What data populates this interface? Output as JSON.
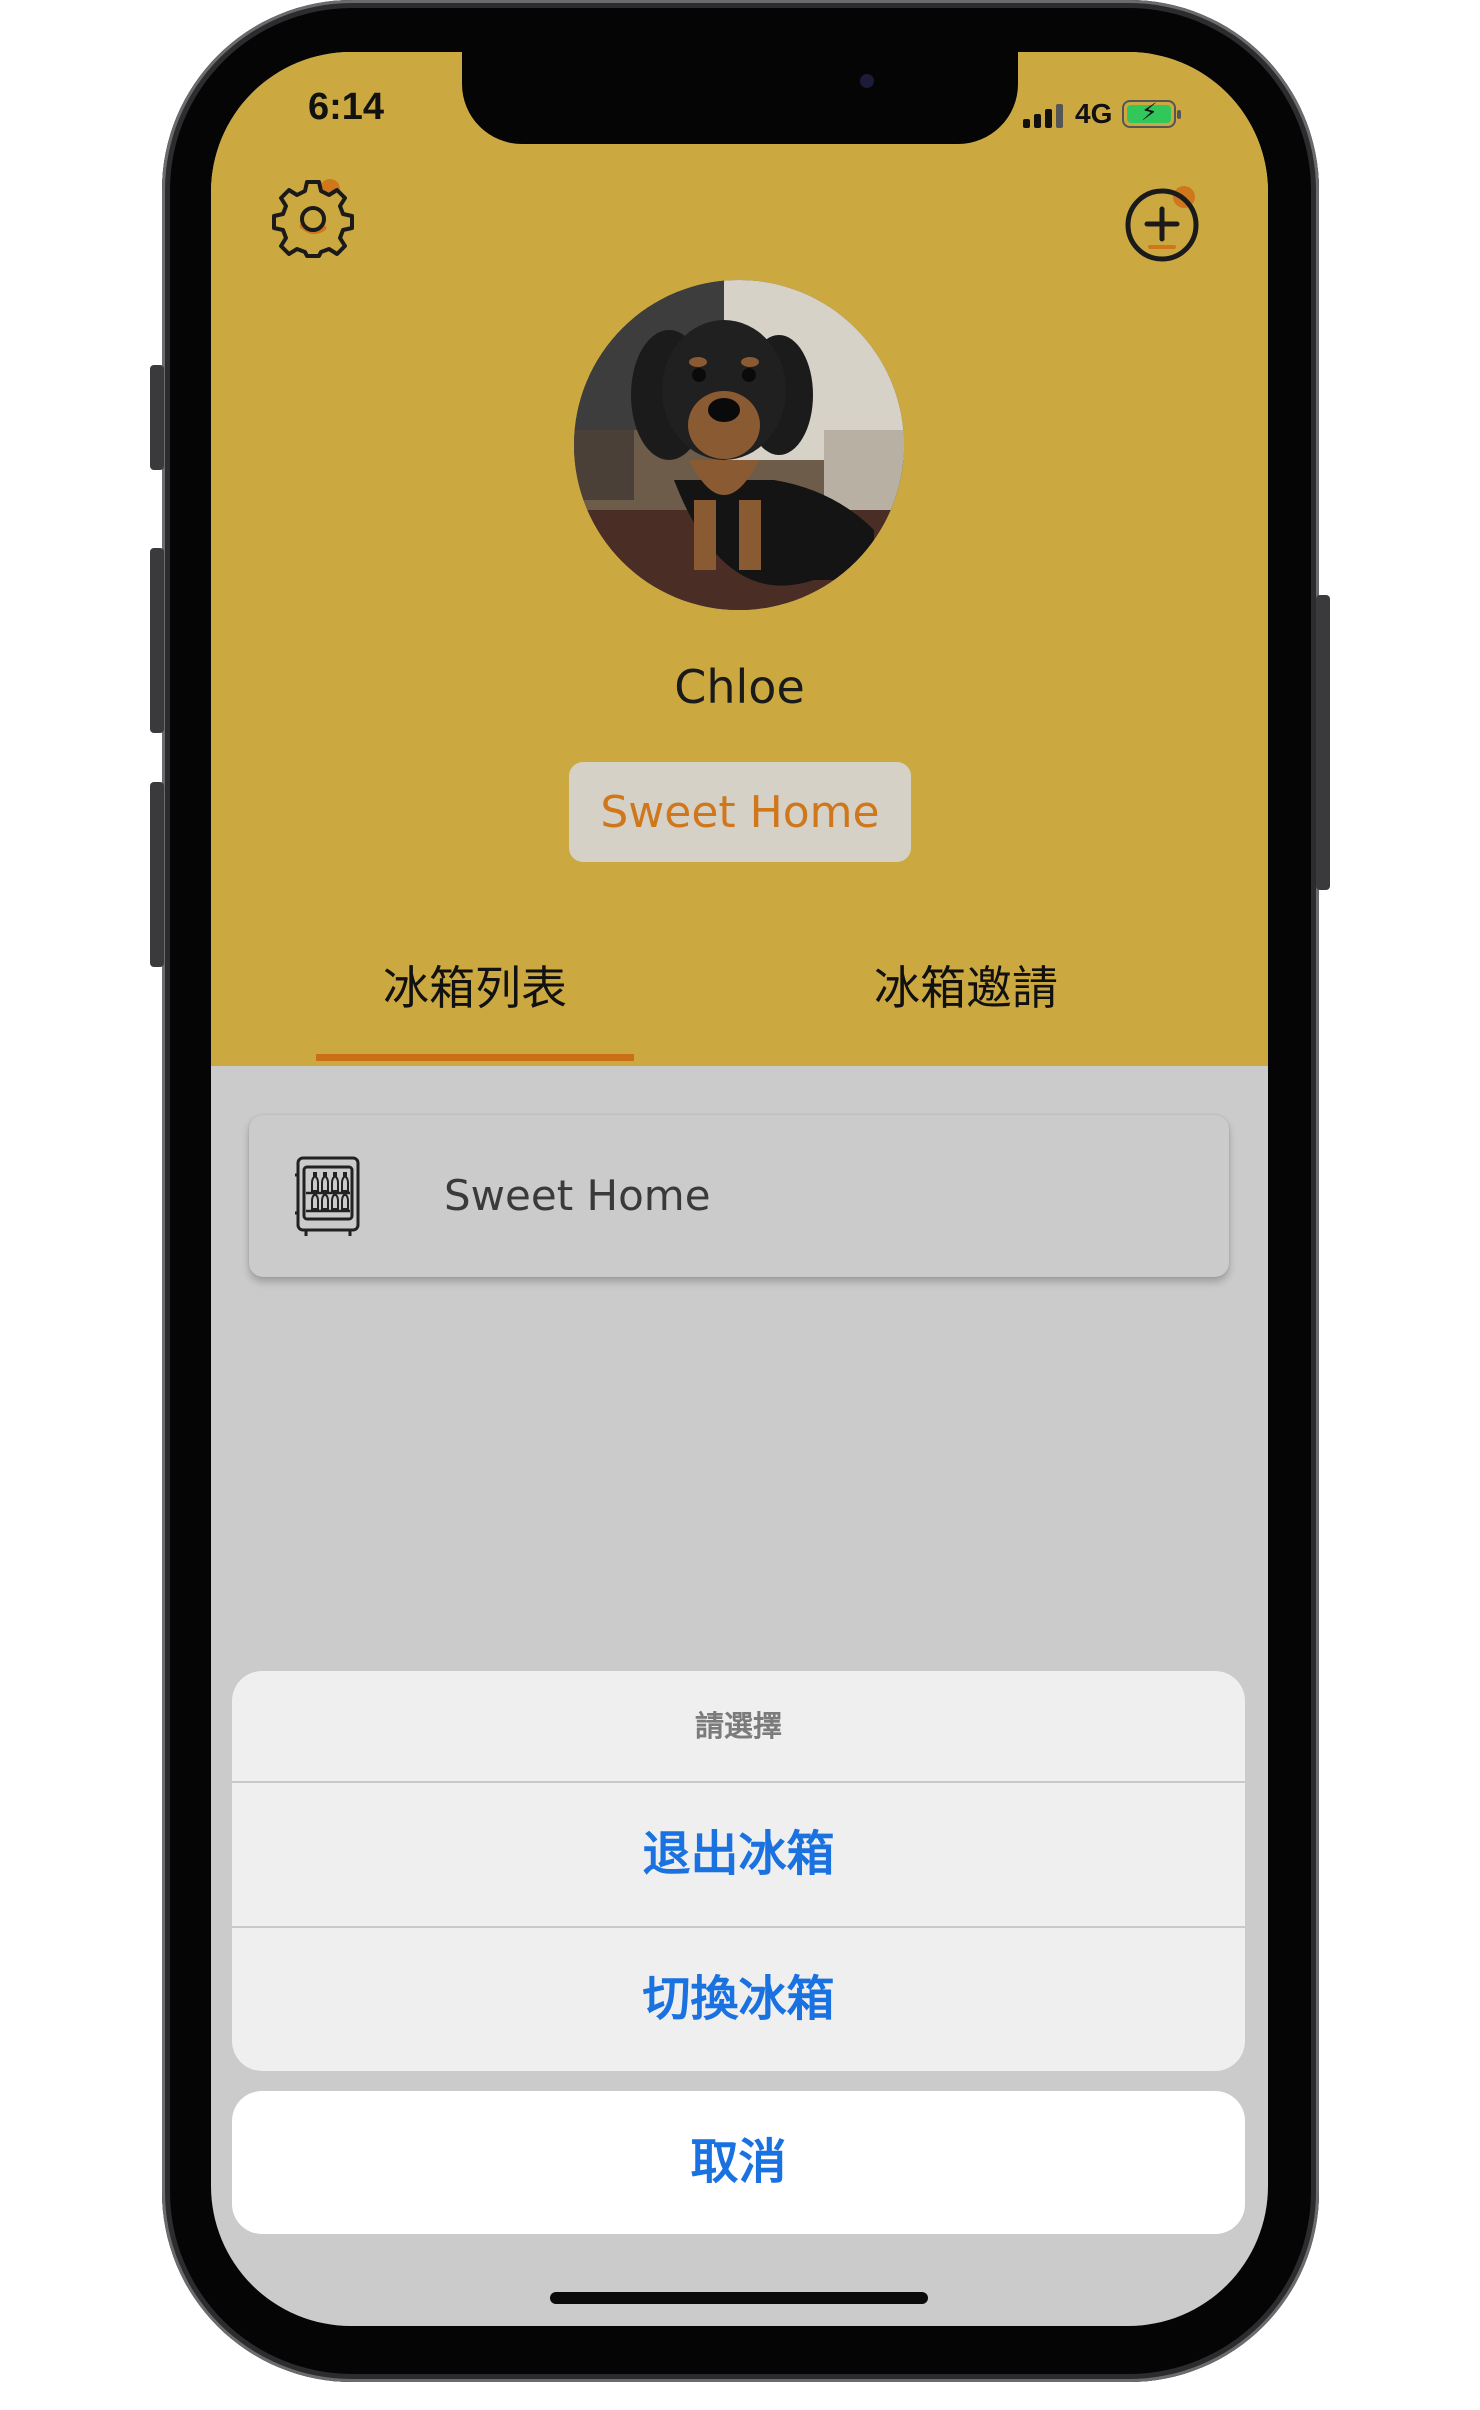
{
  "status_bar": {
    "time": "6:14",
    "network": "4G",
    "battery_charging": true
  },
  "header": {
    "settings_icon": "gear-icon",
    "add_icon": "plus-circle-icon",
    "colors": {
      "background": "#cca940",
      "accent": "#d0771c"
    }
  },
  "profile": {
    "name": "Chloe",
    "current_fridge_button": "Sweet Home",
    "avatar_icon": "dog-photo"
  },
  "tabs": [
    {
      "label": "冰箱列表",
      "active": true
    },
    {
      "label": "冰箱邀請",
      "active": false
    }
  ],
  "fridge_list": [
    {
      "icon": "fridge-icon",
      "name": "Sweet Home"
    }
  ],
  "action_sheet": {
    "title": "請選擇",
    "actions": [
      "退出冰箱",
      "切換冰箱"
    ],
    "cancel": "取消",
    "action_color": "#1a72e0"
  }
}
